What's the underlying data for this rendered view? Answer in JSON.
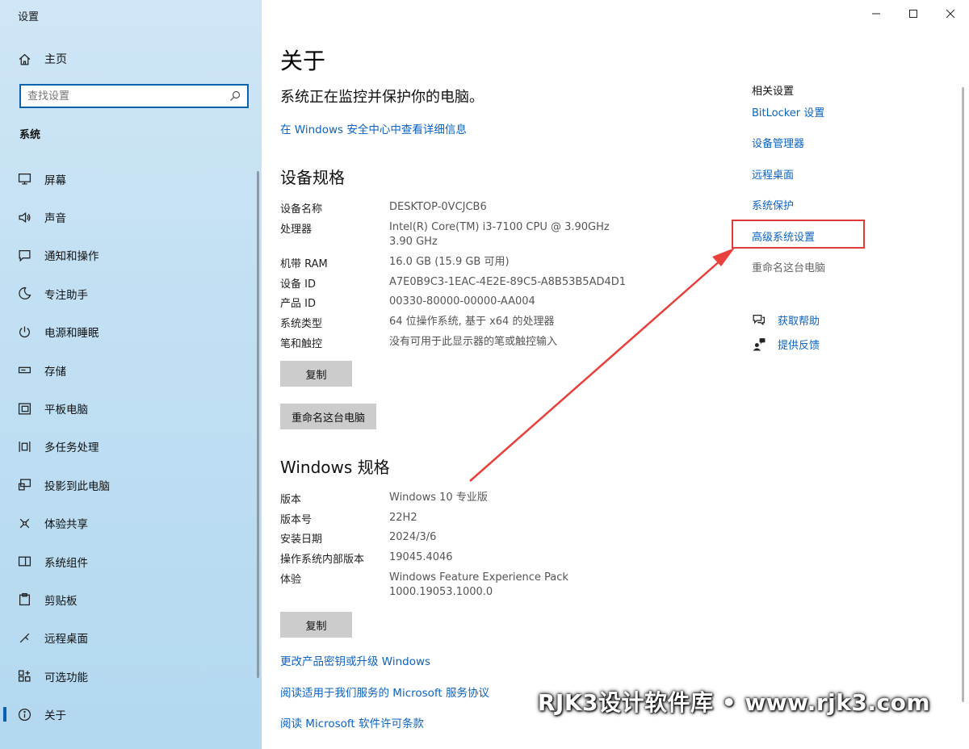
{
  "window": {
    "title": "设置"
  },
  "sidebar": {
    "home_label": "主页",
    "search_placeholder": "查找设置",
    "section_title": "系统",
    "items": [
      {
        "label": "屏幕",
        "icon": "monitor-icon"
      },
      {
        "label": "声音",
        "icon": "speaker-icon"
      },
      {
        "label": "通知和操作",
        "icon": "notification-icon"
      },
      {
        "label": "专注助手",
        "icon": "moon-icon"
      },
      {
        "label": "电源和睡眠",
        "icon": "power-icon"
      },
      {
        "label": "存储",
        "icon": "storage-icon"
      },
      {
        "label": "平板电脑",
        "icon": "tablet-icon"
      },
      {
        "label": "多任务处理",
        "icon": "multitask-icon"
      },
      {
        "label": "投影到此电脑",
        "icon": "project-icon"
      },
      {
        "label": "体验共享",
        "icon": "share-icon"
      },
      {
        "label": "系统组件",
        "icon": "components-icon"
      },
      {
        "label": "剪贴板",
        "icon": "clipboard-icon"
      },
      {
        "label": "远程桌面",
        "icon": "remote-desktop-icon"
      },
      {
        "label": "可选功能",
        "icon": "optional-features-icon"
      },
      {
        "label": "关于",
        "icon": "info-icon",
        "active": true
      }
    ]
  },
  "main": {
    "title": "关于",
    "status": "系统正在监控并保护你的电脑。",
    "security_link": "在 Windows 安全中心中查看详细信息",
    "device_spec": {
      "heading": "设备规格",
      "rows": [
        {
          "label": "设备名称",
          "value": "DESKTOP-0VCJCB6"
        },
        {
          "label": "处理器",
          "value": "Intel(R) Core(TM) i3-7100 CPU @ 3.90GHz   3.90 GHz"
        },
        {
          "label": "机带 RAM",
          "value": "16.0 GB (15.9 GB 可用)"
        },
        {
          "label": "设备 ID",
          "value": "A7E0B9C3-1EAC-4E2E-89C5-A8B53B5AD4D1"
        },
        {
          "label": "产品 ID",
          "value": "00330-80000-00000-AA004"
        },
        {
          "label": "系统类型",
          "value": "64 位操作系统, 基于 x64 的处理器"
        },
        {
          "label": "笔和触控",
          "value": "没有可用于此显示器的笔或触控输入"
        }
      ],
      "copy_button": "复制",
      "rename_button": "重命名这台电脑"
    },
    "windows_spec": {
      "heading": "Windows 规格",
      "rows": [
        {
          "label": "版本",
          "value": "Windows 10 专业版"
        },
        {
          "label": "版本号",
          "value": "22H2"
        },
        {
          "label": "安装日期",
          "value": "2024/3/6"
        },
        {
          "label": "操作系统内部版本",
          "value": "19045.4046"
        },
        {
          "label": "体验",
          "value": "Windows Feature Experience Pack 1000.19053.1000.0"
        }
      ],
      "copy_button": "复制"
    },
    "bottom_links": [
      "更改产品密钥或升级 Windows",
      "阅读适用于我们服务的 Microsoft 服务协议",
      "阅读 Microsoft 软件许可条款"
    ]
  },
  "related": {
    "title": "相关设置",
    "links": [
      "BitLocker 设置",
      "设备管理器",
      "远程桌面",
      "系统保护",
      "高级系统设置"
    ],
    "disabled": "重命名这台电脑",
    "help": "获取帮助",
    "feedback": "提供反馈"
  },
  "annotation": {
    "color": "#e03a3a"
  },
  "watermark": "RJK3设计软件库 • www.rjk3.com"
}
